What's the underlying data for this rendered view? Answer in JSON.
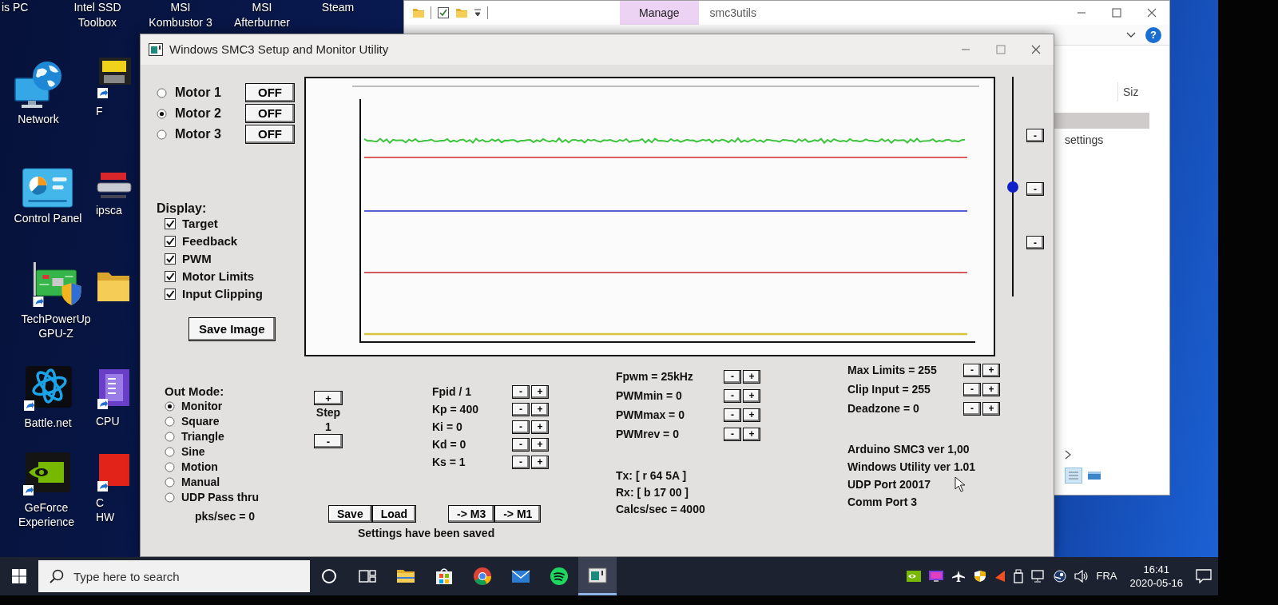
{
  "desktop": {
    "top_labels": [
      {
        "lines": [
          "is PC"
        ]
      },
      {
        "lines": [
          "Intel SSD",
          "Toolbox"
        ]
      },
      {
        "lines": [
          "MSI",
          "Kombustor 3"
        ]
      },
      {
        "lines": [
          "MSI",
          "Afterburner"
        ]
      },
      {
        "lines": [
          "Steam"
        ]
      }
    ],
    "icons": [
      {
        "kind": "globe",
        "lines": [
          "Network"
        ]
      },
      {
        "kind": "panel",
        "lines": [
          "Control Panel"
        ]
      },
      {
        "kind": "board",
        "lines": [
          "TechPowerUp",
          "GPU-Z"
        ]
      },
      {
        "kind": "swirl",
        "lines": [
          "Battle.net"
        ]
      },
      {
        "kind": "eye",
        "lines": [
          "GeForce",
          "Experience"
        ]
      }
    ],
    "partial_icons": [
      {
        "kind": "badge",
        "lines": [
          "F"
        ]
      },
      {
        "kind": "scanner",
        "lines": [
          "ipsca"
        ]
      },
      {
        "kind": "folder"
      },
      {
        "kind": "chip",
        "lines": [
          "CPU"
        ]
      },
      {
        "kind": "block",
        "lines": [
          "C",
          "HW"
        ]
      }
    ]
  },
  "explorer": {
    "context_tab": "Manage",
    "title": "smc3utils",
    "help": "?",
    "column_header": "Siz",
    "row_text": "settings"
  },
  "app": {
    "title": "Windows SMC3 Setup and Monitor Utility",
    "motors": [
      {
        "label": "Motor 1",
        "selected": false,
        "button": "OFF"
      },
      {
        "label": "Motor 2",
        "selected": true,
        "button": "OFF"
      },
      {
        "label": "Motor 3",
        "selected": false,
        "button": "OFF"
      }
    ],
    "display": {
      "label": "Display:",
      "options": [
        {
          "label": "Target",
          "checked": true
        },
        {
          "label": "Feedback",
          "checked": true
        },
        {
          "label": "PWM",
          "checked": true
        },
        {
          "label": "Motor Limits",
          "checked": true
        },
        {
          "label": "Input Clipping",
          "checked": true
        }
      ]
    },
    "save_image": "Save Image",
    "slider": {
      "level": 0.5
    },
    "side_buttons": [
      "-",
      "-",
      "-"
    ],
    "out_mode": {
      "label": "Out Mode:",
      "options": [
        {
          "label": "Monitor",
          "selected": true
        },
        {
          "label": "Square",
          "selected": false
        },
        {
          "label": "Triangle",
          "selected": false
        },
        {
          "label": "Sine",
          "selected": false
        },
        {
          "label": "Motion",
          "selected": false
        },
        {
          "label": "Manual",
          "selected": false
        },
        {
          "label": "UDP Pass thru",
          "selected": false
        }
      ],
      "rate": "pks/sec = 0"
    },
    "step": {
      "increase": "+",
      "label": "Step",
      "value": "1",
      "decrease": "-"
    },
    "settings": {
      "buttons": [
        "Save",
        "Load"
      ],
      "message": "Settings have been saved"
    },
    "pid": [
      {
        "label": "Fpid / 1",
        "buttons": [
          "-",
          "+"
        ]
      },
      {
        "label": "Kp = 400",
        "buttons": [
          "-",
          "+"
        ]
      },
      {
        "label": "Ki = 0",
        "buttons": [
          "-",
          "+"
        ]
      },
      {
        "label": "Kd = 0",
        "buttons": [
          "-",
          "+"
        ]
      },
      {
        "label": "Ks = 1",
        "buttons": [
          "-",
          "+"
        ]
      }
    ],
    "copy_buttons": [
      "-> M3",
      "-> M1"
    ],
    "pwm": [
      {
        "label": "Fpwm = 25kHz",
        "buttons": [
          "-",
          "+"
        ]
      },
      {
        "label": "PWMmin = 0",
        "buttons": [
          "-",
          "+"
        ]
      },
      {
        "label": "PWMmax = 0",
        "buttons": [
          "-",
          "+"
        ]
      },
      {
        "label": "PWMrev = 0",
        "buttons": [
          "-",
          "+"
        ]
      }
    ],
    "comms": [
      "Tx: [ r 64 5A ]",
      "Rx: [ b 17 00 ]",
      "Calcs/sec = 4000"
    ],
    "limits": [
      {
        "label": "Max Limits = 255",
        "buttons": [
          "-",
          "+"
        ]
      },
      {
        "label": "Clip Input = 255",
        "buttons": [
          "-",
          "+"
        ]
      },
      {
        "label": "Deadzone = 0",
        "buttons": [
          "-",
          "+"
        ]
      }
    ],
    "info": [
      "Arduino SMC3 ver 1,00",
      "Windows Utility ver 1.01",
      "UDP Port 20017",
      "Comm Port 3"
    ]
  },
  "taskbar": {
    "search": {
      "placeholder": "Type here to search"
    },
    "pinned": [
      {
        "kind": "folder",
        "active": false
      },
      {
        "kind": "bag",
        "active": false
      },
      {
        "kind": "browser",
        "active": false
      },
      {
        "kind": "mail",
        "active": false
      },
      {
        "kind": "music",
        "active": false
      },
      {
        "kind": "app",
        "active": true
      }
    ],
    "language": "FRA",
    "time": "16:41",
    "date": "2020-05-16"
  }
}
